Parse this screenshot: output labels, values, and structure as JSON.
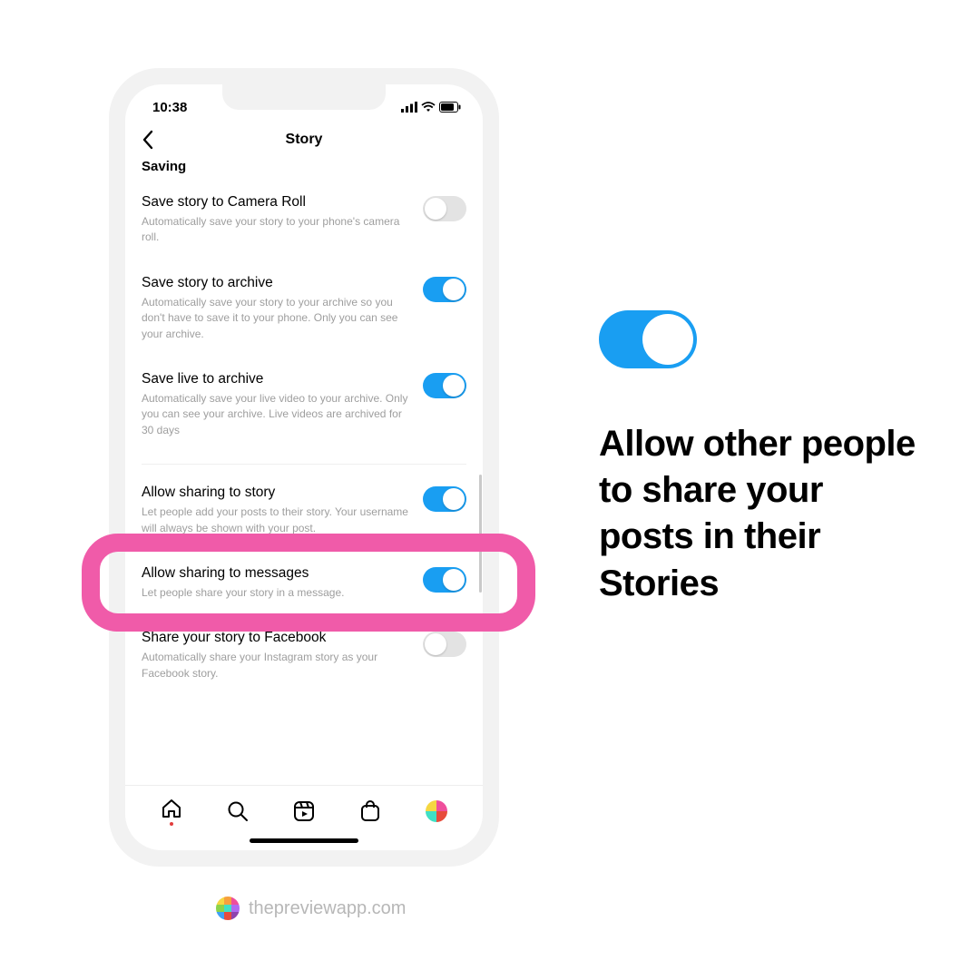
{
  "status": {
    "time": "10:38"
  },
  "nav": {
    "title": "Story"
  },
  "section": {
    "saving": "Saving"
  },
  "settings": [
    {
      "title": "Save story to Camera Roll",
      "desc": "Automatically save your story to your phone's camera roll.",
      "on": false
    },
    {
      "title": "Save story to archive",
      "desc": "Automatically save your story to your archive so you don't have to save it to your phone. Only you can see your archive.",
      "on": true
    },
    {
      "title": "Save live to archive",
      "desc": "Automatically save your live video to your archive. Only you can see your archive. Live videos are archived for 30 days",
      "on": true
    },
    {
      "title": "Allow sharing to story",
      "desc": "Let people add your posts to their story. Your username will always be shown with your post.",
      "on": true
    },
    {
      "title": "Allow sharing to messages",
      "desc": "Let people share your story in a message.",
      "on": true
    },
    {
      "title": "Share your story to Facebook",
      "desc": "Automatically share your Instagram story as your Facebook story.",
      "on": false
    }
  ],
  "callout": {
    "text": "Allow other people to share your posts in their Stories"
  },
  "credit": {
    "text": "thepreviewapp.com"
  },
  "colors": {
    "accent": "#199ef2",
    "highlight": "#f05ba9"
  }
}
